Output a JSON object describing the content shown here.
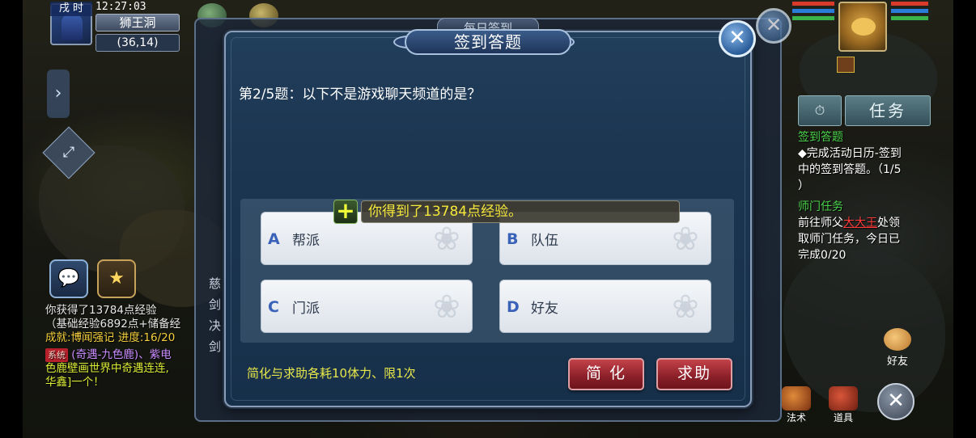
{
  "status": {
    "time_period": "戌 时",
    "clock": "12:27:03",
    "location_name": "狮王洞",
    "coordinates": "(36,14)"
  },
  "left_chat": {
    "line1": "你获得了13784点经验",
    "line2": "（基础经验6892点+储备经",
    "line3_prefix": "成就:",
    "line3": "博闻强记  进度:16/20",
    "line4_tag": "系统",
    "line4": "(奇遇-九色鹿)、紫电",
    "line5": "色鹿壁画世界中奇遇连连,",
    "line6": "华鑫]一个！"
  },
  "right_panel": {
    "task_button": "任务",
    "task1_title": "签到答题",
    "task1_desc_a": "◆完成活动日历-签到",
    "task1_desc_b": "中的签到答题。（1/5",
    "task1_desc_c": "）",
    "task2_title": "师门任务",
    "task2_desc_a_pre": "前往师父",
    "task2_desc_a_npc": "大大王",
    "task2_desc_a_post": "处领",
    "task2_desc_b": "取师门任务，今日已",
    "task2_desc_c": "完成0/20",
    "friend_label": "好友",
    "skill_label": "法术",
    "item_label": "道具"
  },
  "back_panel": {
    "title": "每日签到",
    "side_chars": [
      "慈",
      "剑",
      "决",
      "剑"
    ]
  },
  "dialog": {
    "title": "签到答题",
    "question": "第2/5题：以下不是游戏聊天频道的是？",
    "notification": "你得到了13784点经验。",
    "options": [
      {
        "letter": "A",
        "text": "帮派"
      },
      {
        "letter": "B",
        "text": "队伍"
      },
      {
        "letter": "C",
        "text": "门派"
      },
      {
        "letter": "D",
        "text": "好友"
      }
    ],
    "hint": "简化与求助各耗10体力、限1次",
    "simplify_label": "简 化",
    "help_label": "求助"
  },
  "colors": {
    "hint_yellow": "#e9e84a",
    "notify_yellow": "#f5e83a",
    "task_green": "#4bd34b",
    "npc_red": "#ff3b3b",
    "button_red": "#a8303a"
  }
}
